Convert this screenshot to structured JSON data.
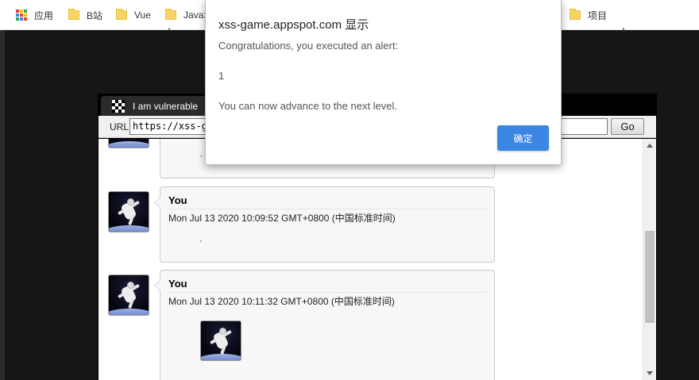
{
  "bookmarks": {
    "items": [
      {
        "label": "应用",
        "icon": "apps-grid-icon"
      },
      {
        "label": "B站",
        "icon": "folder-icon"
      },
      {
        "label": "Vue",
        "icon": "folder-icon"
      },
      {
        "label": "JavaS",
        "icon": "folder-icon"
      },
      {
        "label": "项目",
        "icon": "folder-icon"
      }
    ]
  },
  "game_frame": {
    "tab_title": "I am vulnerable",
    "url_label": "URL",
    "url_value": "https://xss-g",
    "go_label": "Go"
  },
  "posts": [
    {
      "author": "You",
      "date": "Mon Jul 13 2020 10:09:52 GMT+0800 (中国标准时间)"
    },
    {
      "author": "You",
      "date": "Mon Jul 13 2020 10:11:32 GMT+0800 (中国标准时间)"
    }
  ],
  "dialog": {
    "title": "xss-game.appspot.com 显示",
    "line1": "Congratulations, you executed an alert:",
    "line2": "1",
    "line3": "You can now advance to the next level.",
    "ok_label": "确定"
  },
  "colors": {
    "ok_button": "#3b86e3",
    "folder": "#f7d564",
    "page_background": "#161616"
  }
}
